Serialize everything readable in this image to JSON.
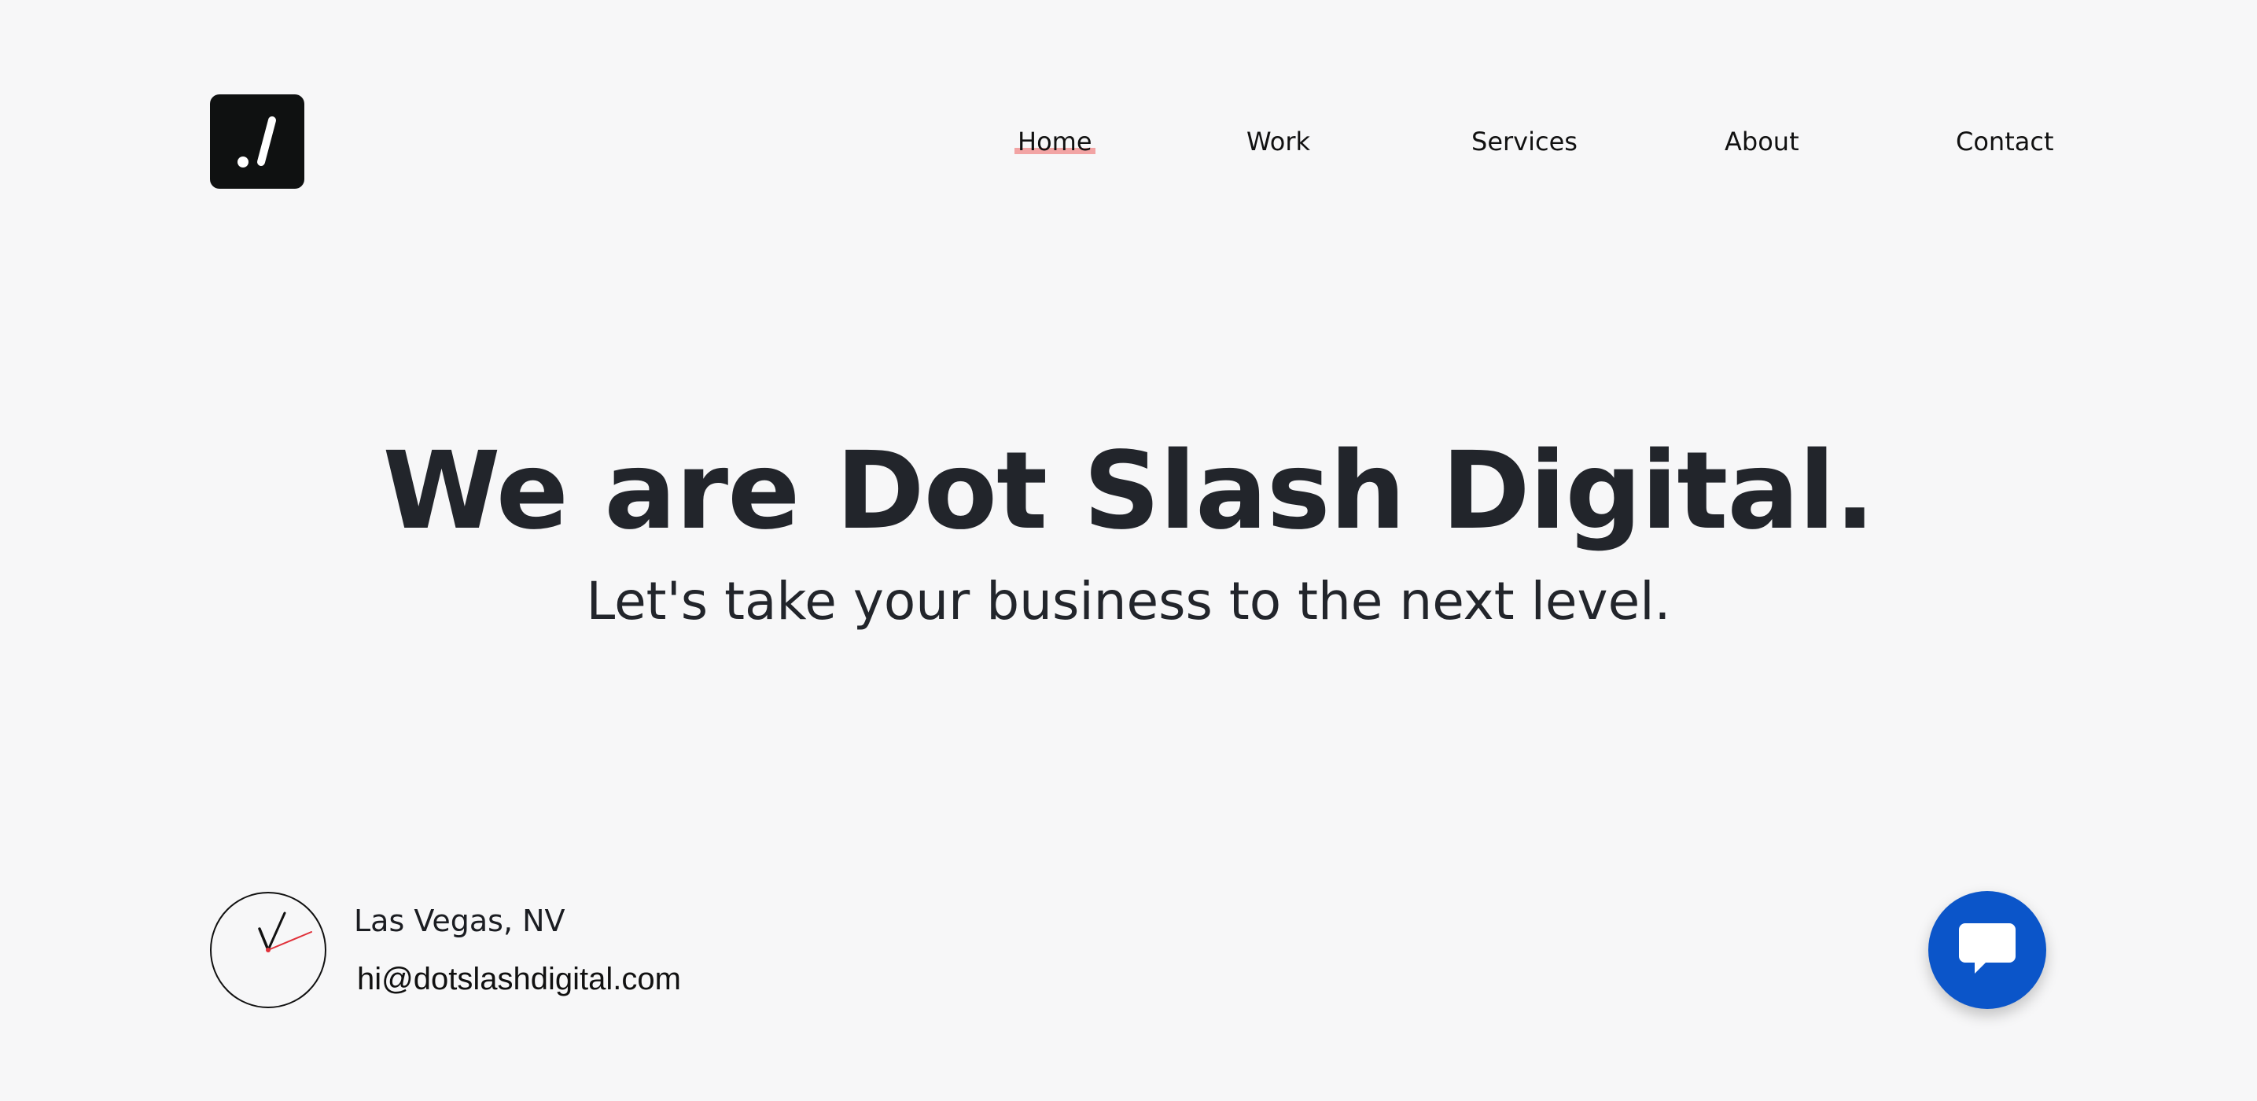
{
  "logo": {
    "text": "./",
    "icon": "dot-slash-logo"
  },
  "nav": {
    "items": [
      {
        "label": "Home",
        "active": true
      },
      {
        "label": "Work"
      },
      {
        "label": "Services"
      },
      {
        "label": "About"
      },
      {
        "label": "Contact"
      }
    ]
  },
  "hero": {
    "title": "We are Dot Slash Digital.",
    "subtitle": "Let's take your business to the next level."
  },
  "footer": {
    "location": "Las Vegas, NV",
    "email": "hi@dotslashdigital.com",
    "clock_icon": "analog-clock-icon"
  },
  "chat": {
    "icon": "chat-bubble-icon",
    "color": "#0b55c9"
  },
  "colors": {
    "background": "#f7f7f8",
    "text": "#22252b",
    "active_highlight": "#f2a4a4",
    "clock_second_hand": "#e0313a"
  }
}
